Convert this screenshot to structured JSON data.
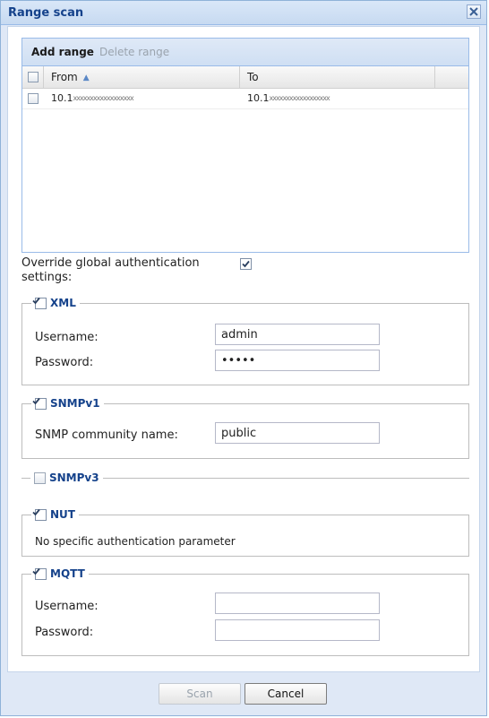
{
  "window": {
    "title": "Range scan",
    "close_icon": "close-icon"
  },
  "grid": {
    "toolbar": {
      "add_label": "Add range",
      "delete_label": "Delete range"
    },
    "columns": {
      "from": "From",
      "to": "To"
    },
    "sort": {
      "column": "From",
      "direction": "ascending",
      "icon": "sort-ascending-icon"
    },
    "rows": [
      {
        "from_prefix": "10.1",
        "from_masked": "xxxxxxxxxxxxxxxxxx",
        "to_prefix": "10.1",
        "to_masked": "xxxxxxxxxxxxxxxxxx",
        "selected": false
      }
    ]
  },
  "override": {
    "label_line1": "Override global authentication",
    "label_line2": "settings:",
    "checked": true
  },
  "xml": {
    "legend": "XML",
    "checked": true,
    "username_label": "Username:",
    "username_value": "admin",
    "password_label": "Password:",
    "password_value": "•••••"
  },
  "snmpv1": {
    "legend": "SNMPv1",
    "checked": true,
    "community_label": "SNMP community name:",
    "community_value": "public"
  },
  "snmpv3": {
    "legend": "SNMPv3",
    "checked": false
  },
  "nut": {
    "legend": "NUT",
    "checked": true,
    "note": "No specific authentication parameter"
  },
  "mqtt": {
    "legend": "MQTT",
    "checked": true,
    "username_label": "Username:",
    "username_value": "",
    "password_label": "Password:",
    "password_value": ""
  },
  "footer": {
    "scan_label": "Scan",
    "cancel_label": "Cancel"
  },
  "colors": {
    "title_text": "#15428b",
    "window_border": "#99bbe8",
    "legend_text": "#15428b"
  }
}
